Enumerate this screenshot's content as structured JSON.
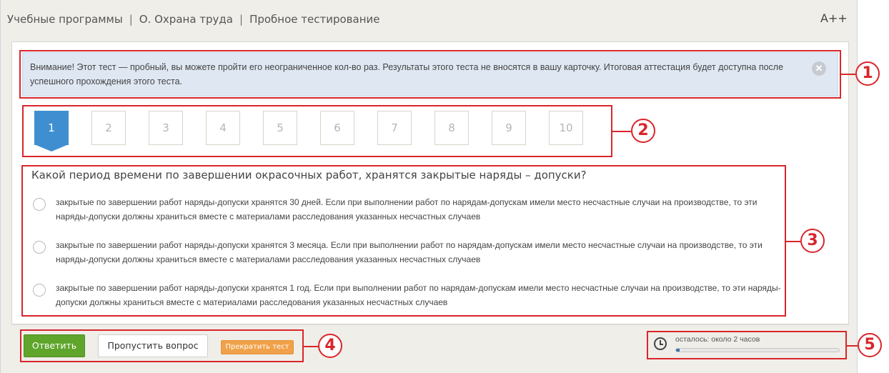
{
  "breadcrumb": {
    "item1": "Учебные программы",
    "separator": "|",
    "item2": "О. Охрана труда",
    "item3": "Пробное тестирование"
  },
  "font_size_control": "A++",
  "notice": {
    "text": "Внимание! Этот тест — пробный, вы можете пройти его неограниченное кол-во раз. Результаты этого теста не вносятся в вашу карточку. Итоговая аттестация будет доступна после успешного прохождения этого теста.",
    "close_glyph": "✕"
  },
  "question_nav": {
    "items": [
      "1",
      "2",
      "3",
      "4",
      "5",
      "6",
      "7",
      "8",
      "9",
      "10"
    ],
    "active": "1"
  },
  "question": {
    "text": "Какой период времени по завершении окрасочных работ, хранятся закрытые наряды – допуски?",
    "answers": [
      "закрытые по завершении работ наряды-допуски хранятся 30 дней. Если при выполнении работ по нарядам-допускам имели место несчастные случаи на производстве, то эти наряды-допуски должны храниться вместе с материалами расследования указанных несчастных случаев",
      "закрытые по завершении работ наряды-допуски хранятся 3 месяца. Если при выполнении работ по нарядам-допускам имели место несчастные случаи на производстве, то эти наряды-допуски должны храниться вместе с материалами расследования указанных несчастных случаев",
      "закрытые по завершении работ наряды-допуски хранятся 1 год. Если при выполнении работ по нарядам-допускам имели место несчастные случаи на производстве, то эти наряды-допуски должны храниться вместе с материалами расследования указанных несчастных случаев"
    ]
  },
  "actions": {
    "answer_label": "Ответить",
    "skip_label": "Пропустить вопрос",
    "stop_label": "Прекратить тест"
  },
  "timer": {
    "text": "осталось: около 2 часов",
    "progress_fraction": 0.02,
    "icon": "clock-icon"
  },
  "annotations": {
    "labels": [
      "1",
      "2",
      "3",
      "4",
      "5"
    ],
    "color": "#d9262b"
  },
  "colors": {
    "active_question": "#3f8fd0",
    "answer_button": "#5fa52b",
    "stop_button": "#f0a14a",
    "notice_bg": "#dfe7f2"
  }
}
